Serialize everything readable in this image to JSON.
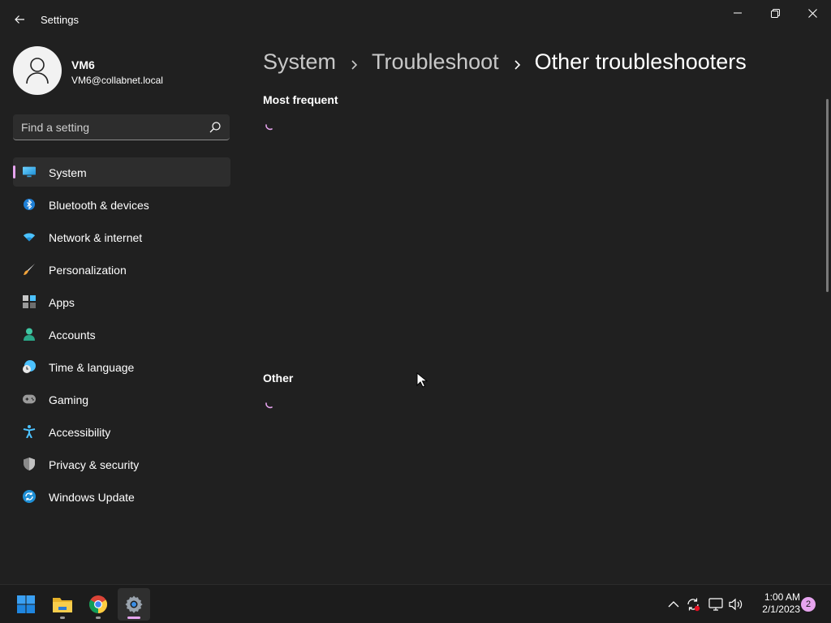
{
  "window": {
    "title": "Settings",
    "controls": [
      "minimize",
      "restore",
      "close"
    ]
  },
  "profile": {
    "name": "VM6",
    "email": "VM6@collabnet.local"
  },
  "search": {
    "placeholder": "Find a setting"
  },
  "sidebar": {
    "items": [
      {
        "label": "System",
        "icon": "monitor-icon",
        "selected": true
      },
      {
        "label": "Bluetooth & devices",
        "icon": "bluetooth-icon"
      },
      {
        "label": "Network & internet",
        "icon": "wifi-icon"
      },
      {
        "label": "Personalization",
        "icon": "brush-icon"
      },
      {
        "label": "Apps",
        "icon": "apps-icon"
      },
      {
        "label": "Accounts",
        "icon": "person-icon"
      },
      {
        "label": "Time & language",
        "icon": "clock-globe-icon"
      },
      {
        "label": "Gaming",
        "icon": "gamepad-icon"
      },
      {
        "label": "Accessibility",
        "icon": "accessibility-icon"
      },
      {
        "label": "Privacy & security",
        "icon": "shield-icon"
      },
      {
        "label": "Windows Update",
        "icon": "update-icon"
      }
    ]
  },
  "breadcrumb": [
    "System",
    "Troubleshoot",
    "Other troubleshooters"
  ],
  "sections": {
    "most_frequent": "Most frequent",
    "other": "Other"
  },
  "taskbar": {
    "apps": [
      "start-icon",
      "file-explorer-icon",
      "chrome-icon",
      "settings-icon"
    ],
    "active_app": "settings-icon",
    "tray": [
      "chevron-up-icon",
      "sync-icon",
      "network-icon",
      "volume-icon"
    ],
    "time": "1:00 AM",
    "date": "2/1/2023",
    "notification_count": "2"
  },
  "colors": {
    "accent": "#e6a4ee",
    "background": "#202020",
    "nav_selected": "#2d2d2d",
    "taskbar": "#1c1c1c"
  }
}
